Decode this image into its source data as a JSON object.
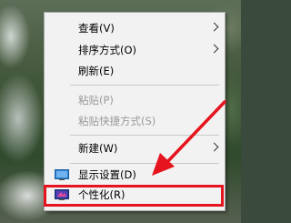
{
  "menu": {
    "items": [
      {
        "label": "查看(V)",
        "submenu": true,
        "enabled": true
      },
      {
        "label": "排序方式(O)",
        "submenu": true,
        "enabled": true
      },
      {
        "label": "刷新(E)",
        "submenu": false,
        "enabled": true
      },
      {
        "label": "粘贴(P)",
        "submenu": false,
        "enabled": false
      },
      {
        "label": "粘贴快捷方式(S)",
        "submenu": false,
        "enabled": false
      },
      {
        "label": "新建(W)",
        "submenu": true,
        "enabled": true
      },
      {
        "label": "显示设置(D)",
        "submenu": false,
        "enabled": true,
        "icon": "display-icon"
      },
      {
        "label": "个性化(R)",
        "submenu": false,
        "enabled": true,
        "icon": "personalize-icon"
      }
    ]
  },
  "annotation": {
    "highlight_color": "#e6141e",
    "target_item": "个性化(R)"
  }
}
